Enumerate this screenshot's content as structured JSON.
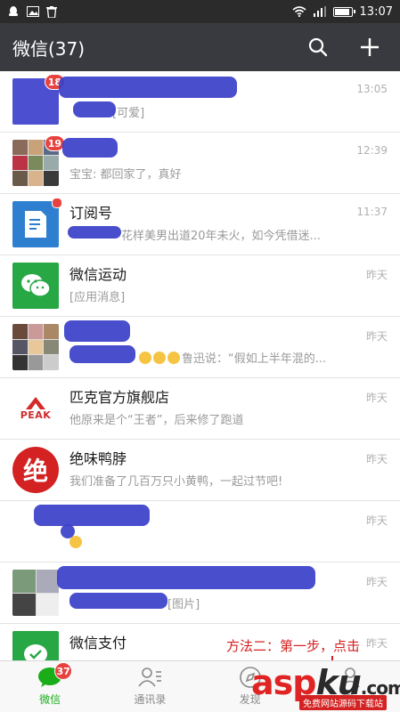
{
  "status_bar": {
    "time": "13:07",
    "signal": "4G"
  },
  "header": {
    "title": "微信(37)",
    "search_icon": "search-icon",
    "add_icon": "plus-icon"
  },
  "chats": [
    {
      "name": "",
      "message": "[可爱]",
      "time": "13:05",
      "badge": "18"
    },
    {
      "name": "",
      "message": "宝宝: 都回家了，真好",
      "time": "12:39",
      "badge": "19"
    },
    {
      "name": "订阅号",
      "message": "花样美男出道20年未火，如今凭借迷...",
      "time": "11:37",
      "badge": ""
    },
    {
      "name": "微信运动",
      "message": "[应用消息]",
      "time": "昨天",
      "badge": ""
    },
    {
      "name": "",
      "message": "鲁迅说：“假如上半年混的...",
      "time": "昨天",
      "badge": ""
    },
    {
      "name": "匹克官方旗舰店",
      "message": "他原来是个“王者”，后来修了跑道",
      "time": "昨天",
      "badge": ""
    },
    {
      "name": "绝味鸭脖",
      "message": "我们准备了几百万只小黄鸭，一起过节吧!",
      "time": "昨天",
      "badge": ""
    },
    {
      "name": "",
      "message": "",
      "time": "昨天",
      "badge": ""
    },
    {
      "name": "",
      "message": "[图片]",
      "time": "昨天",
      "badge": ""
    },
    {
      "name": "微信支付",
      "message": "",
      "time": "昨天",
      "badge": ""
    }
  ],
  "peak_logo_text": "PEAK",
  "juewei_logo_char": "绝",
  "annotation": "方法二：第一步，点击",
  "tabs": [
    {
      "label": "微信",
      "badge": "37"
    },
    {
      "label": "通讯录",
      "badge": ""
    },
    {
      "label": "发现",
      "badge": ""
    },
    {
      "label": "我",
      "badge": ""
    }
  ],
  "watermark": {
    "main": "asp",
    "ku": "ku",
    "tld": ".com",
    "sub": "免费网站源码下载站"
  },
  "colors": {
    "accent": "#1aad19",
    "header_bg": "#393a3f",
    "badge": "#e64340",
    "annotation": "#d42121"
  }
}
